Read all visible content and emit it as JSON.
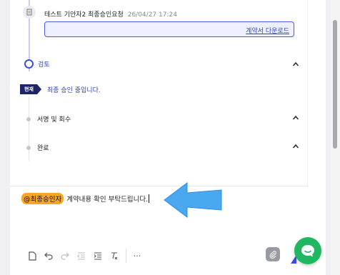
{
  "timeline": {
    "log": {
      "actor": "테스트 기안자2",
      "action": "최종승인요청",
      "time": "26/04/27 17:24"
    },
    "download_label": "계약서 다운로드",
    "steps": [
      {
        "label": "검토",
        "state": "active"
      },
      {
        "label": "서명 및 회수",
        "state": "pending"
      },
      {
        "label": "완료",
        "state": "pending"
      }
    ],
    "current": {
      "badge": "현재",
      "text": "최종 승인 중입니다."
    }
  },
  "editor": {
    "mention": "@최종승인자",
    "text": "계약내용 확인 부탁드립니다."
  },
  "toolbar": {
    "more_label": "···"
  },
  "colors": {
    "accent": "#3b4fd8",
    "badge_bg": "#1d2467",
    "mention_bg": "#f5a623",
    "chat_fab": "#1fb860",
    "arrow": "#4aa8f0"
  },
  "icons": [
    "document-icon",
    "undo-icon",
    "redo-icon",
    "outdent-icon",
    "indent-icon",
    "clear-format-icon",
    "more-icon",
    "paperclip-icon",
    "send-icon",
    "chat-icon",
    "chevron-up-icon"
  ]
}
